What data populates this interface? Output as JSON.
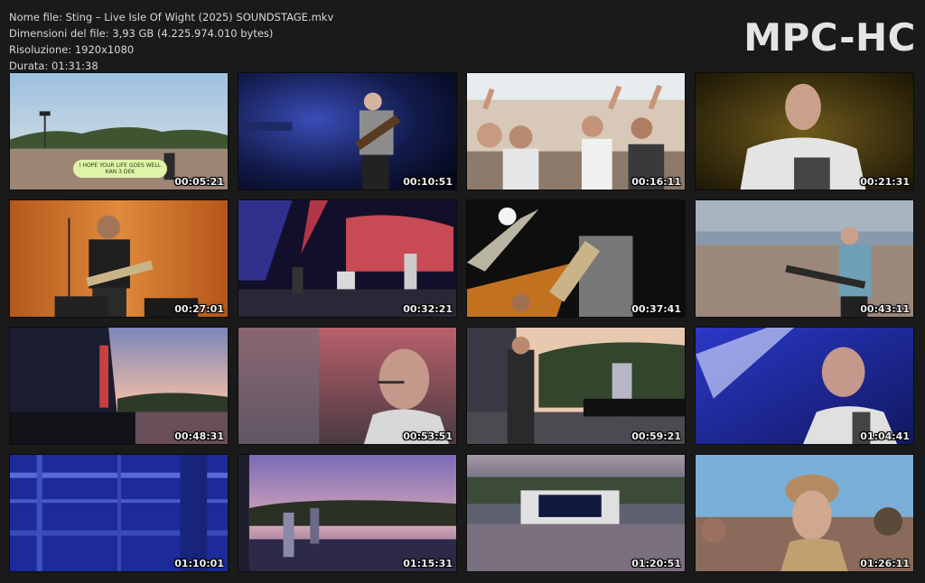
{
  "header": {
    "file_name": "Nome file: Sting – Live Isle Of Wight (2025) SOUNDSTAGE.mkv",
    "file_size": "Dimensioni del file: 3,93 GB (4.225.974.010 bytes)",
    "resolution": "Risoluzione: 1920x1080",
    "duration": "Durata: 01:31:38"
  },
  "brand": "MPC-HC",
  "thumbnails": [
    {
      "time": "00:05:21",
      "sign": "I HOPE YOUR LIFE GOES WELL KAN 3 DEK"
    },
    {
      "time": "00:10:51"
    },
    {
      "time": "00:16:11"
    },
    {
      "time": "00:21:31"
    },
    {
      "time": "00:27:01"
    },
    {
      "time": "00:32:21"
    },
    {
      "time": "00:37:41"
    },
    {
      "time": "00:43:11"
    },
    {
      "time": "00:48:31"
    },
    {
      "time": "00:53:51"
    },
    {
      "time": "00:59:21"
    },
    {
      "time": "01:04:41"
    },
    {
      "time": "01:10:01"
    },
    {
      "time": "01:15:31"
    },
    {
      "time": "01:20:51"
    },
    {
      "time": "01:26:11"
    }
  ],
  "colors": {
    "background": "#1a1a1a",
    "text": "#d8d8d8",
    "brand": "#e4e4e4"
  }
}
